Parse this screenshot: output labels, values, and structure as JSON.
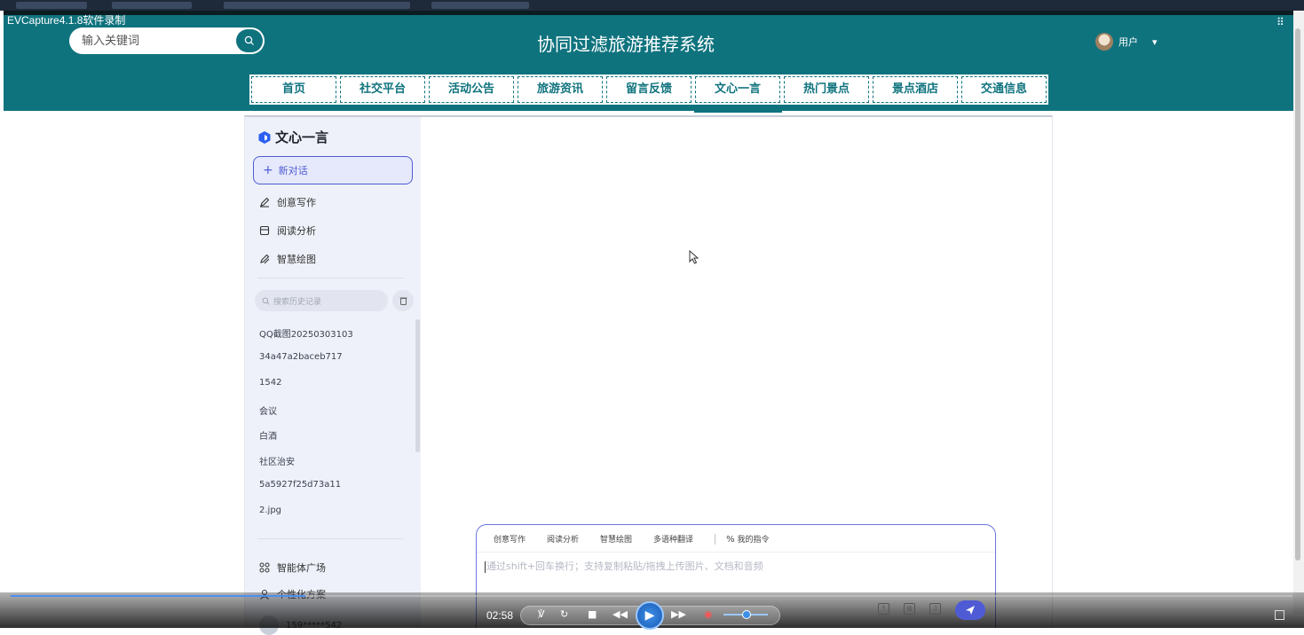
{
  "recorder": {
    "label": "EVCapture4.1.8软件录制"
  },
  "header": {
    "search_placeholder": "输入关键词",
    "title": "协同过滤旅游推荐系统",
    "user_label": "用户"
  },
  "nav": {
    "items": [
      {
        "label": "首页"
      },
      {
        "label": "社交平台"
      },
      {
        "label": "活动公告"
      },
      {
        "label": "旅游资讯"
      },
      {
        "label": "留言反馈"
      },
      {
        "label": "文心一言",
        "active": true
      },
      {
        "label": "热门景点"
      },
      {
        "label": "景点酒店"
      },
      {
        "label": "交通信息"
      }
    ]
  },
  "sidebar": {
    "logo_text": "文心一言",
    "new_chat": "新对话",
    "tools": [
      {
        "label": "创意写作",
        "icon": "pen-icon"
      },
      {
        "label": "阅读分析",
        "icon": "document-icon"
      },
      {
        "label": "智慧绘图",
        "icon": "brush-icon"
      }
    ],
    "history_search_placeholder": "搜索历史记录",
    "history": [
      "QQ截图20250303103",
      "34a47a2baceb717",
      "1542",
      "会议",
      "白酒",
      "社区治安",
      "5a5927f25d73a11",
      "2.jpg"
    ],
    "agent_square": "智能体广场",
    "personal_plan": "个性化方案",
    "account": "159*****542"
  },
  "chat": {
    "chips": [
      "创意写作",
      "阅读分析",
      "智慧绘图",
      "多语种翻译"
    ],
    "my_command": "我的指令",
    "input_placeholder": "通过shift+回车换行；支持复制粘贴/拖拽上传图片、文档和音频"
  },
  "player": {
    "time": "02:58",
    "progress": 0.23
  },
  "colors": {
    "brand": "#0f737e",
    "accent": "#4f5bd5",
    "sidebar_bg": "#eef1f9"
  }
}
